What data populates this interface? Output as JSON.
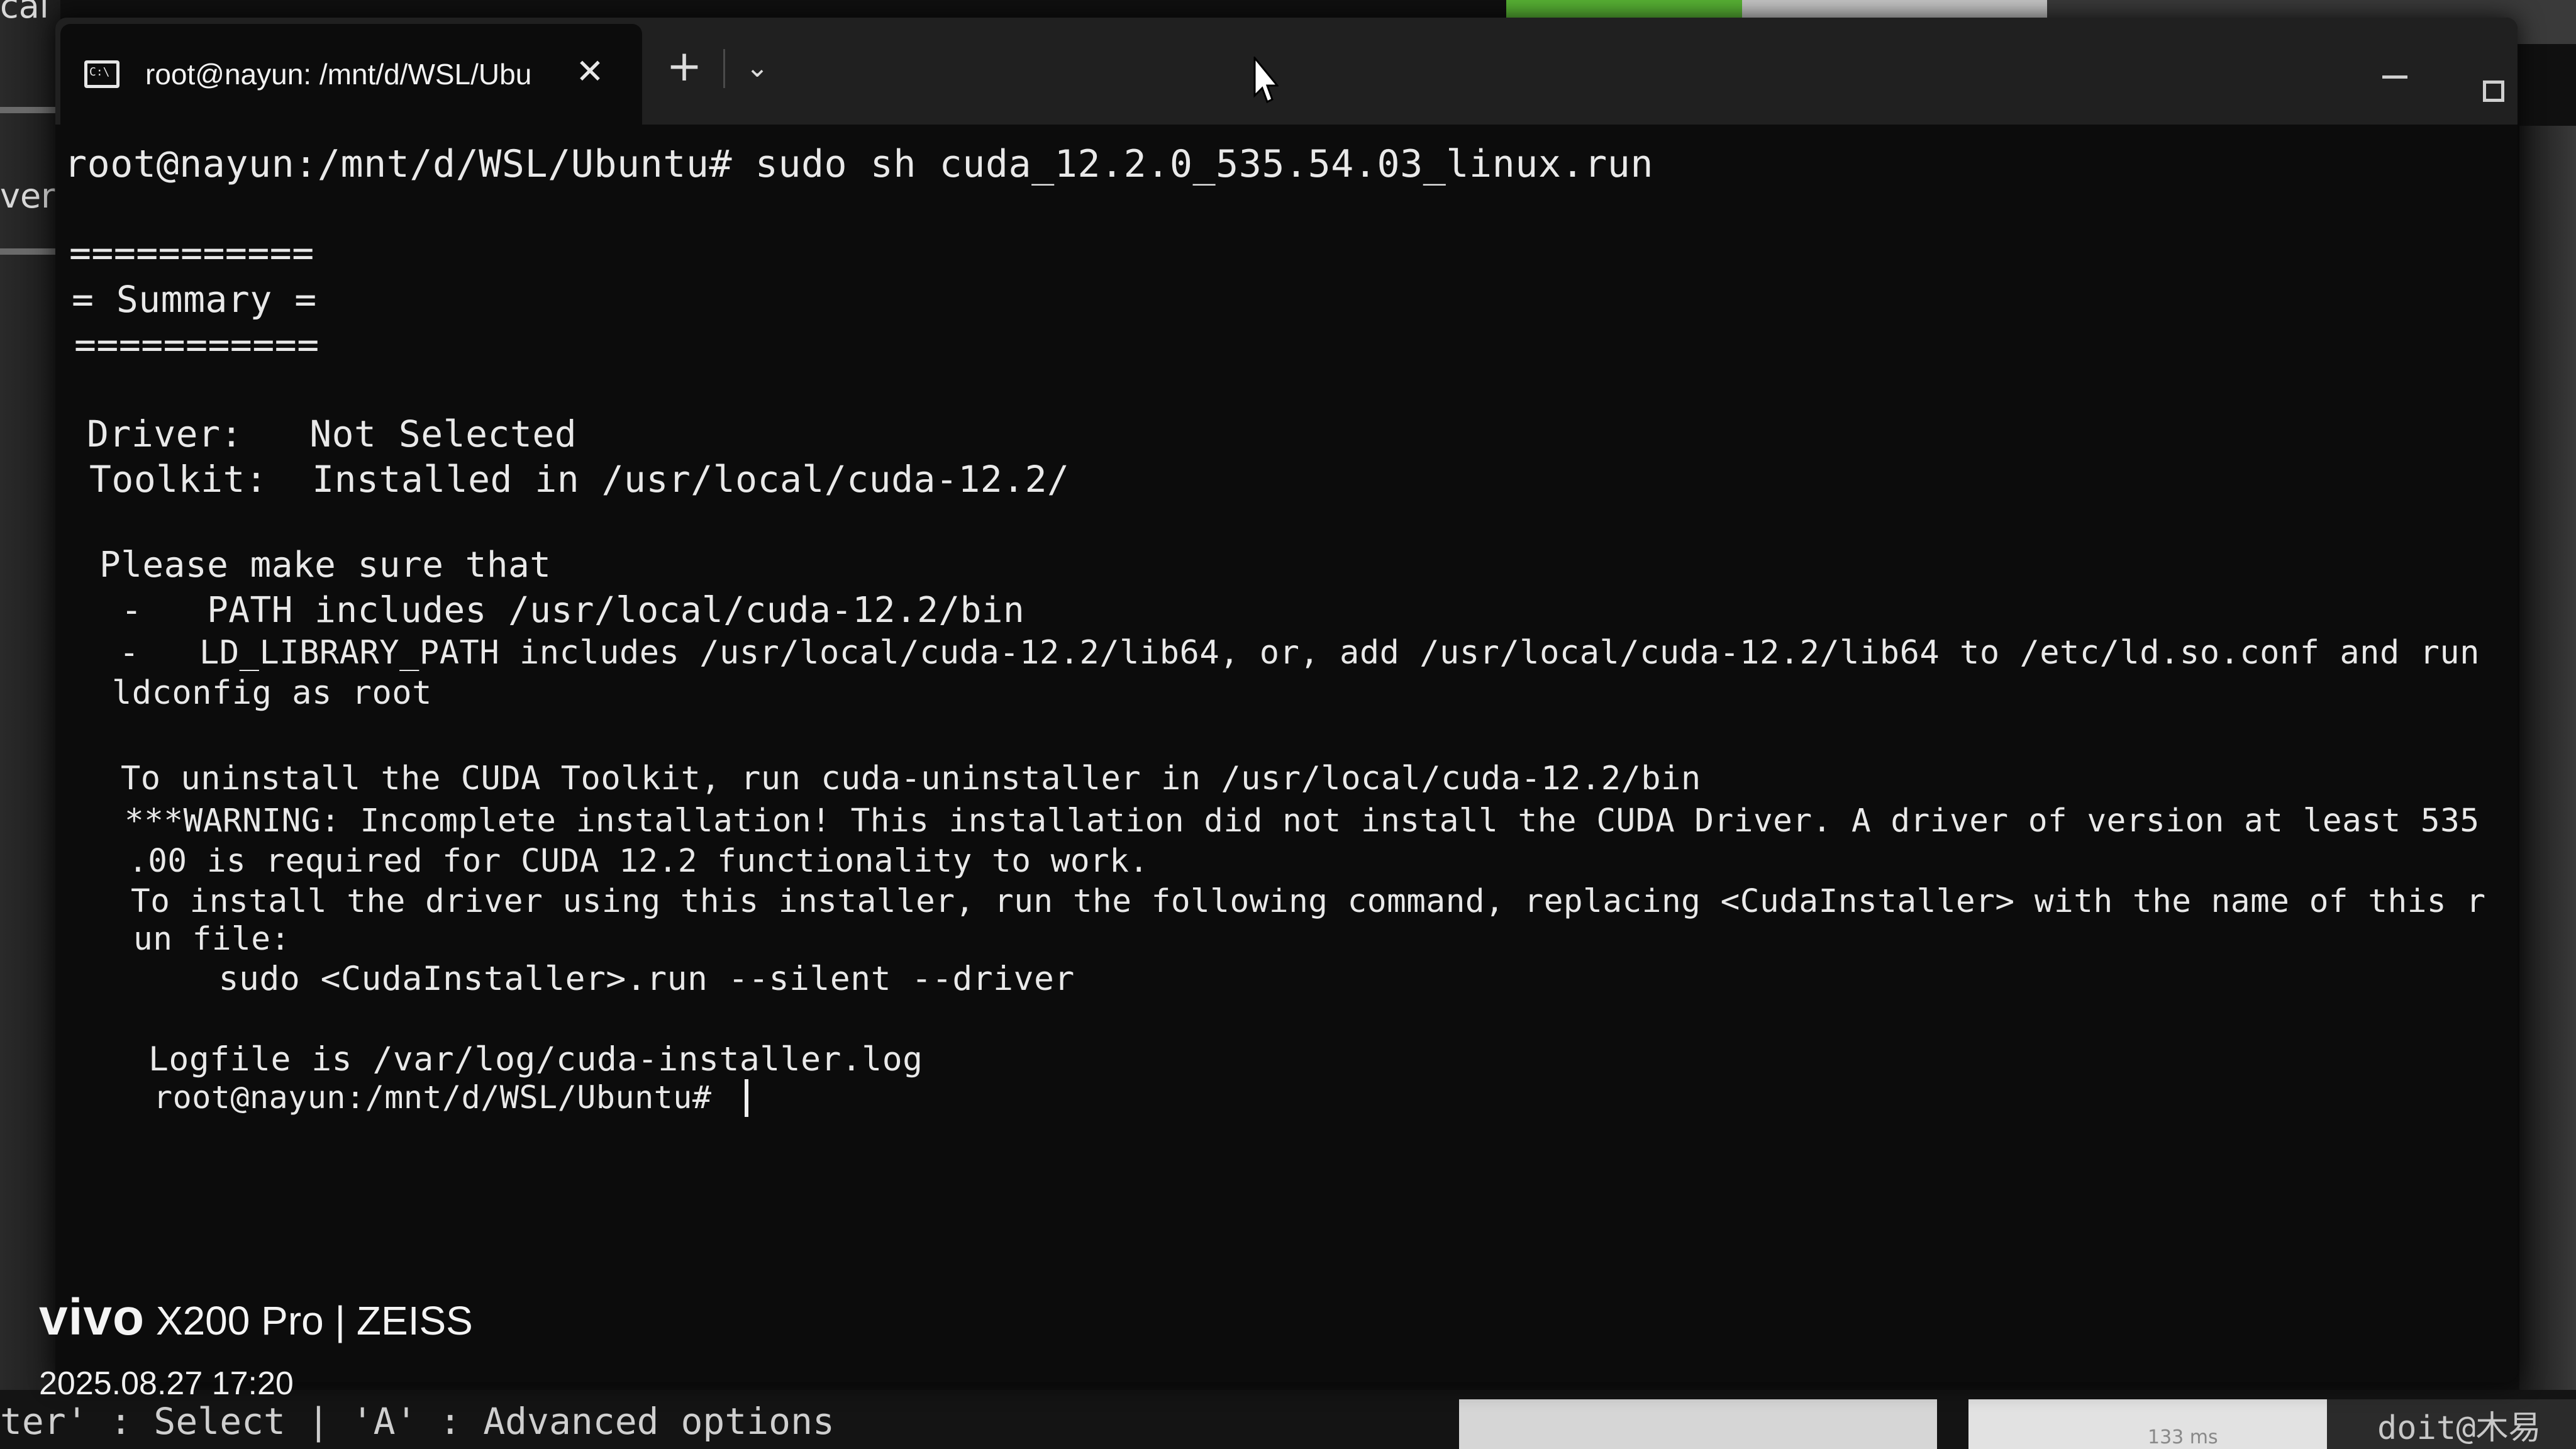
{
  "window": {
    "tab_title": "root@nayun: /mnt/d/WSL/Ubu",
    "tab_icon_text": "C:\\",
    "close_glyph": "✕",
    "new_tab_glyph": "+",
    "dropdown_glyph": "⌄"
  },
  "terminal": {
    "lines": [
      "root@nayun:/mnt/d/WSL/Ubuntu# sudo sh cuda_12.2.0_535.54.03_linux.run",
      "===========",
      "= Summary =",
      "===========",
      "Driver:   Not Selected",
      "Toolkit:  Installed in /usr/local/cuda-12.2/",
      "Please make sure that",
      " -   PATH includes /usr/local/cuda-12.2/bin",
      " -   LD_LIBRARY_PATH includes /usr/local/cuda-12.2/lib64, or, add /usr/local/cuda-12.2/lib64 to /etc/ld.so.conf and run",
      "ldconfig as root",
      "To uninstall the CUDA Toolkit, run cuda-uninstaller in /usr/local/cuda-12.2/bin",
      "***WARNING: Incomplete installation! This installation did not install the CUDA Driver. A driver of version at least 535",
      ".00 is required for CUDA 12.2 functionality to work.",
      "To install the driver using this installer, run the following command, replacing <CudaInstaller> with the name of this r",
      "un file:",
      "    sudo <CudaInstaller>.run --silent --driver",
      "Logfile is /var/log/cuda-installer.log",
      "root@nayun:/mnt/d/WSL/Ubuntu# "
    ]
  },
  "background": {
    "left_label_top": "cal",
    "left_label": "ver",
    "bottom_text": "ter' : Select | 'A' : Advanced options",
    "latency": "133 ms",
    "watermark": "doit@木易"
  },
  "camera": {
    "brand": "vivo",
    "model": " X200 Pro | ZEISS",
    "datetime": "2025.08.27 17:20"
  },
  "colors": {
    "terminal_bg": "#0c0c0c",
    "terminal_fg": "#e9e9e9",
    "titlebar_bg": "#202020"
  }
}
